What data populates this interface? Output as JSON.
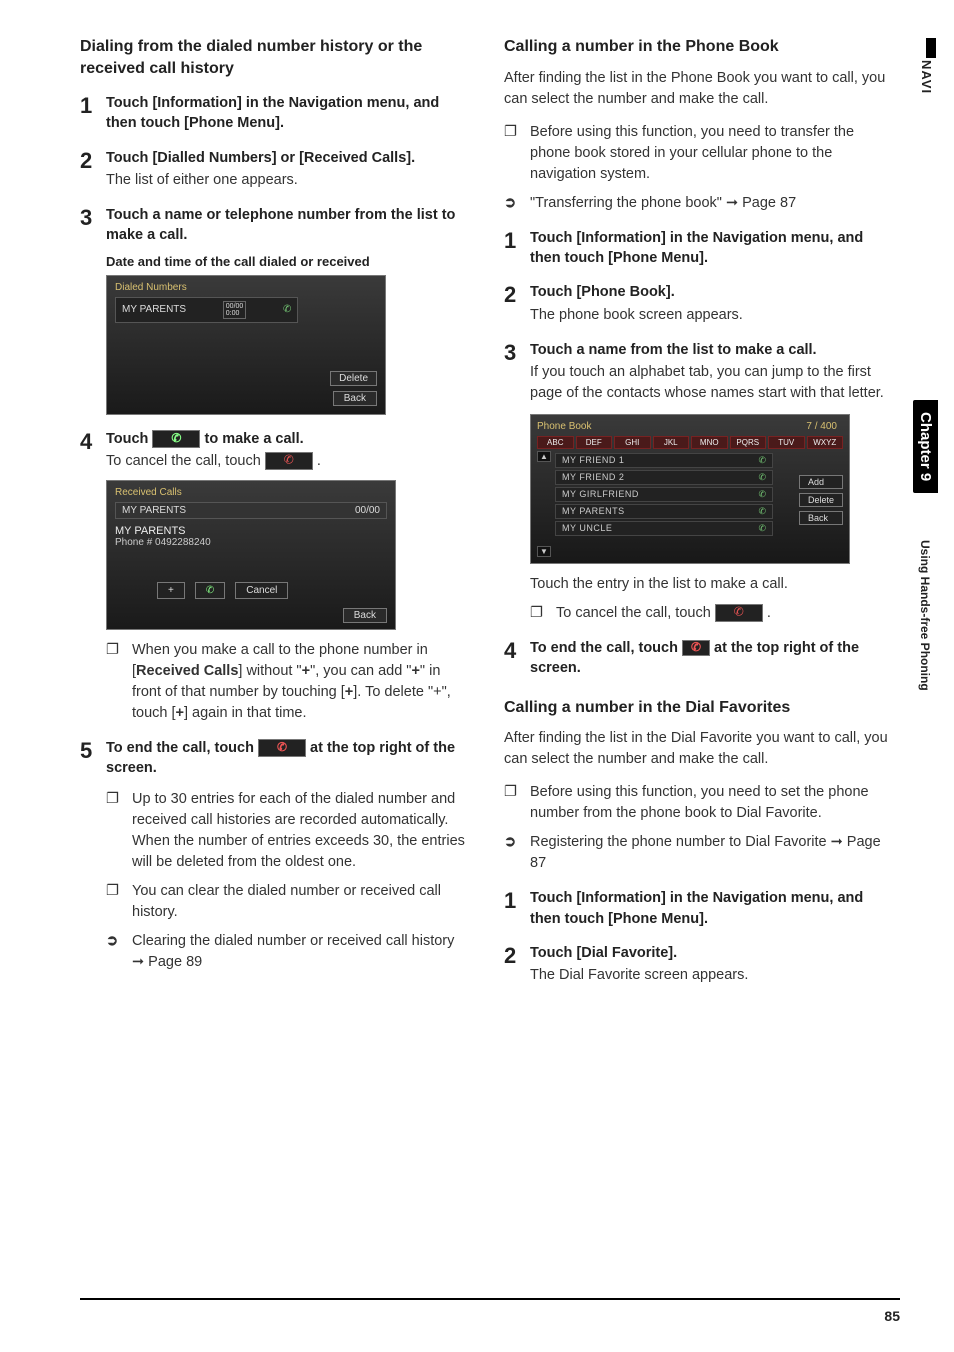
{
  "sidebar": {
    "navi": "NAVI",
    "chapter": "Chapter 9",
    "section": "Using Hands-free Phoning"
  },
  "footer": {
    "page": "85"
  },
  "left": {
    "heading": "Dialing from the dialed number history or the received call history",
    "steps": {
      "s1": {
        "bold": "Touch [Information] in the Navigation menu, and then touch [Phone Menu]."
      },
      "s2": {
        "bold": "Touch [Dialled Numbers] or [Received Calls].",
        "sub": "The list of either one appears."
      },
      "s3": {
        "bold": "Touch a name or telephone number from the list to make a call.",
        "caption": "Date and time of the call dialed or received"
      },
      "s4": {
        "bold_a": "Touch ",
        "bold_b": " to make a call.",
        "sub_a": "To cancel the call, touch ",
        "sub_b": "."
      },
      "s5": {
        "bold_a": "To end the call, touch ",
        "bold_b": " at the top right of the screen."
      }
    },
    "bullets4": {
      "b1_a": "When you make a call to the phone number in [",
      "b1_bold": "Received Calls",
      "b1_b": "] without \"",
      "b1_plus1": "+",
      "b1_c": "\", you can add \"",
      "b1_plus2": "+",
      "b1_d": "\" in front of that number by touching [",
      "b1_plus3": "+",
      "b1_e": "]. To delete \"+\", touch [",
      "b1_plus4": "+",
      "b1_f": "] again in that time."
    },
    "bullets5": {
      "b1": "Up to 30 entries for each of the dialed number and received call histories are recorded automatically. When the number of entries exceeds 30, the entries will be deleted from the oldest one.",
      "b2": "You can clear the dialed number or received call history."
    },
    "ref5": {
      "text": "Clearing the dialed number or received call history ➞ Page 89"
    },
    "dialed": {
      "title": "Dialed Numbers",
      "row": "MY PARENTS",
      "time": "00/00\n0:00",
      "delete": "Delete",
      "back": "Back"
    },
    "received": {
      "title": "Received Calls",
      "hdr_row": "MY PARENTS",
      "hdr_time": "00/00",
      "big": "MY PARENTS",
      "phone": "Phone # 0492288240",
      "plus": "+",
      "cancel": "Cancel",
      "back": "Back"
    }
  },
  "right": {
    "h1": "Calling a number in the Phone Book",
    "p1": "After finding the list in the Phone Book you want to call, you can select the number and make the call.",
    "bul1": "Before using this function, you need to transfer the phone book stored in your cellular phone to the navigation system.",
    "ref1": "\"Transferring the phone book\" ➞ Page 87",
    "s1": "Touch [Information] in the Navigation menu, and then touch [Phone Menu].",
    "s2_bold": "Touch [Phone Book].",
    "s2_sub": "The phone book screen appears.",
    "s3_bold": "Touch a name from the list to make a call.",
    "s3_sub": "If you touch an alphabet tab, you can jump to the first page of the contacts whose names start with that letter.",
    "pb": {
      "title": "Phone Book",
      "count": "7 / 400",
      "tabs": [
        "ABC",
        "DEF",
        "GHI",
        "JKL",
        "MNO",
        "PQRS",
        "TUV",
        "WXYZ"
      ],
      "rows": [
        "MY FRIEND 1",
        "MY FRIEND 2",
        "MY GIRLFRIEND",
        "MY PARENTS",
        "MY UNCLE"
      ],
      "add": "Add",
      "delete": "Delete",
      "back": "Back"
    },
    "after_pb": "Touch the entry in the list to make a call.",
    "after_pb_bul_a": "To cancel the call, touch ",
    "after_pb_bul_b": ".",
    "s4_a": "To end the call, touch ",
    "s4_b": " at the top right of the  screen.",
    "h2": "Calling a number in the Dial Favorites",
    "p2": "After finding the list in the Dial Favorite you want to call, you can select the number and make the call.",
    "bul2": "Before using this function, you need to set the phone number from the phone book to Dial Favorite.",
    "ref2": "Registering the phone number to Dial Favorite ➞ Page 87",
    "sA": "Touch [Information] in the Navigation menu, and then touch [Phone Menu].",
    "sB_bold": "Touch [Dial Favorite].",
    "sB_sub": "The Dial Favorite screen appears."
  }
}
